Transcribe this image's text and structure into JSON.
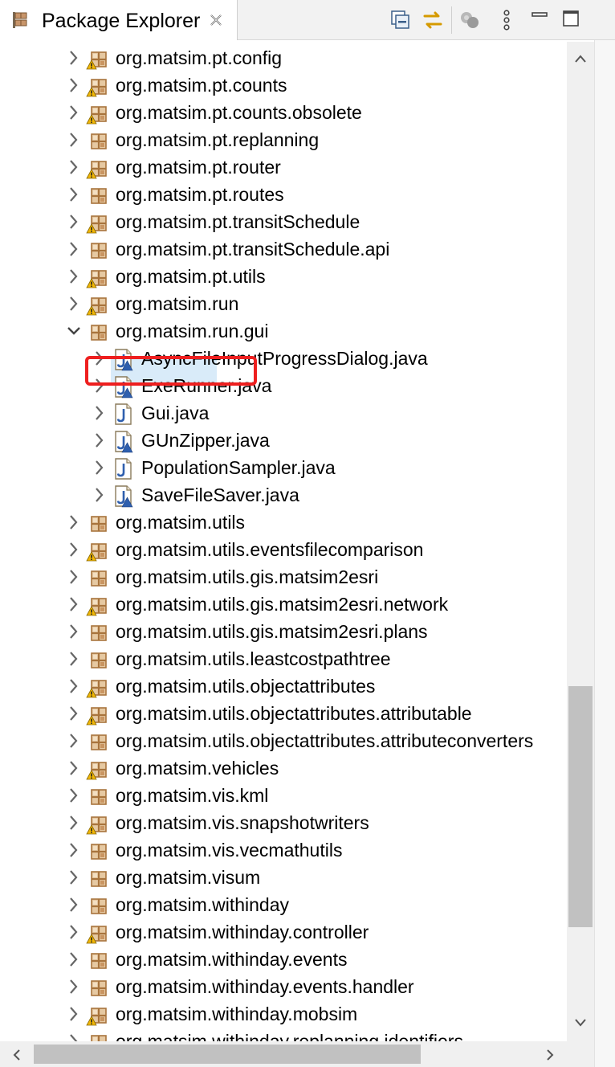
{
  "view": {
    "title": "Package Explorer",
    "icons": [
      "package-explorer-icon",
      "close-icon",
      "collapse-all-icon",
      "link-with-editor-icon",
      "focus-icon",
      "view-menu-icon",
      "minimize-icon",
      "maximize-icon"
    ]
  },
  "tree": [
    {
      "label": "org.matsim.pt.config",
      "type": "package",
      "warning": true,
      "expanded": false,
      "indent": 0
    },
    {
      "label": "org.matsim.pt.counts",
      "type": "package",
      "warning": true,
      "expanded": false,
      "indent": 0
    },
    {
      "label": "org.matsim.pt.counts.obsolete",
      "type": "package",
      "warning": true,
      "expanded": false,
      "indent": 0
    },
    {
      "label": "org.matsim.pt.replanning",
      "type": "package",
      "warning": false,
      "expanded": false,
      "indent": 0
    },
    {
      "label": "org.matsim.pt.router",
      "type": "package",
      "warning": true,
      "expanded": false,
      "indent": 0
    },
    {
      "label": "org.matsim.pt.routes",
      "type": "package",
      "warning": false,
      "expanded": false,
      "indent": 0
    },
    {
      "label": "org.matsim.pt.transitSchedule",
      "type": "package",
      "warning": true,
      "expanded": false,
      "indent": 0
    },
    {
      "label": "org.matsim.pt.transitSchedule.api",
      "type": "package",
      "warning": false,
      "expanded": false,
      "indent": 0
    },
    {
      "label": "org.matsim.pt.utils",
      "type": "package",
      "warning": true,
      "expanded": false,
      "indent": 0
    },
    {
      "label": "org.matsim.run",
      "type": "package",
      "warning": true,
      "expanded": false,
      "indent": 0
    },
    {
      "label": "org.matsim.run.gui",
      "type": "package",
      "warning": false,
      "expanded": true,
      "indent": 0
    },
    {
      "label": "AsyncFileInputProgressDialog.java",
      "type": "java",
      "warning": true,
      "expanded": false,
      "indent": 1
    },
    {
      "label": "ExeRunner.java",
      "type": "java",
      "warning": true,
      "expanded": false,
      "indent": 1
    },
    {
      "label": "Gui.java",
      "type": "java",
      "warning": false,
      "expanded": false,
      "indent": 1,
      "selected": true
    },
    {
      "label": "GUnZipper.java",
      "type": "java",
      "warning": true,
      "expanded": false,
      "indent": 1
    },
    {
      "label": "PopulationSampler.java",
      "type": "java",
      "warning": false,
      "expanded": false,
      "indent": 1
    },
    {
      "label": "SaveFileSaver.java",
      "type": "java",
      "warning": true,
      "expanded": false,
      "indent": 1
    },
    {
      "label": "org.matsim.utils",
      "type": "package",
      "warning": false,
      "expanded": false,
      "indent": 0
    },
    {
      "label": "org.matsim.utils.eventsfilecomparison",
      "type": "package",
      "warning": true,
      "expanded": false,
      "indent": 0
    },
    {
      "label": "org.matsim.utils.gis.matsim2esri",
      "type": "package",
      "warning": false,
      "expanded": false,
      "indent": 0
    },
    {
      "label": "org.matsim.utils.gis.matsim2esri.network",
      "type": "package",
      "warning": true,
      "expanded": false,
      "indent": 0
    },
    {
      "label": "org.matsim.utils.gis.matsim2esri.plans",
      "type": "package",
      "warning": false,
      "expanded": false,
      "indent": 0
    },
    {
      "label": "org.matsim.utils.leastcostpathtree",
      "type": "package",
      "warning": false,
      "expanded": false,
      "indent": 0
    },
    {
      "label": "org.matsim.utils.objectattributes",
      "type": "package",
      "warning": true,
      "expanded": false,
      "indent": 0
    },
    {
      "label": "org.matsim.utils.objectattributes.attributable",
      "type": "package",
      "warning": true,
      "expanded": false,
      "indent": 0
    },
    {
      "label": "org.matsim.utils.objectattributes.attributeconverters",
      "type": "package",
      "warning": false,
      "expanded": false,
      "indent": 0
    },
    {
      "label": "org.matsim.vehicles",
      "type": "package",
      "warning": true,
      "expanded": false,
      "indent": 0
    },
    {
      "label": "org.matsim.vis.kml",
      "type": "package",
      "warning": false,
      "expanded": false,
      "indent": 0
    },
    {
      "label": "org.matsim.vis.snapshotwriters",
      "type": "package",
      "warning": true,
      "expanded": false,
      "indent": 0
    },
    {
      "label": "org.matsim.vis.vecmathutils",
      "type": "package",
      "warning": false,
      "expanded": false,
      "indent": 0
    },
    {
      "label": "org.matsim.visum",
      "type": "package",
      "warning": false,
      "expanded": false,
      "indent": 0
    },
    {
      "label": "org.matsim.withinday",
      "type": "package",
      "warning": false,
      "expanded": false,
      "indent": 0
    },
    {
      "label": "org.matsim.withinday.controller",
      "type": "package",
      "warning": true,
      "expanded": false,
      "indent": 0
    },
    {
      "label": "org.matsim.withinday.events",
      "type": "package",
      "warning": false,
      "expanded": false,
      "indent": 0
    },
    {
      "label": "org.matsim.withinday.events.handler",
      "type": "package",
      "warning": false,
      "expanded": false,
      "indent": 0
    },
    {
      "label": "org.matsim.withinday.mobsim",
      "type": "package",
      "warning": true,
      "expanded": false,
      "indent": 0
    },
    {
      "label": "org.matsim.withinday.replanning.identifiers",
      "type": "package",
      "warning": false,
      "expanded": false,
      "indent": 0
    }
  ],
  "colors": {
    "package": "#a8743d",
    "java_blue": "#2f5fae",
    "warning": "#f2b705",
    "selection_outline": "#ee1f1f",
    "selection_fill": "#d9ebf9"
  }
}
